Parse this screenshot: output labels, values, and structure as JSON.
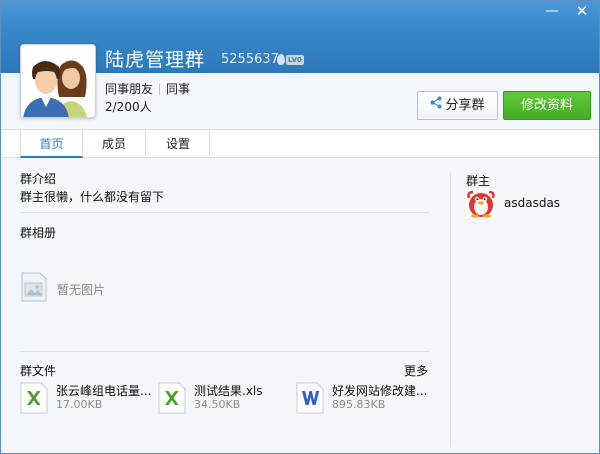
{
  "window": {
    "minimize_glyph": "—",
    "close_glyph": "✕"
  },
  "profile": {
    "name": "陆虎管理群",
    "group_id": "5255637",
    "level_badge": "LV0",
    "tags": [
      "同事朋友",
      "同事"
    ],
    "members": "2/200人",
    "avatar_icon": "group-avatar-icon"
  },
  "actions": {
    "share_label": "分享群",
    "edit_label": "修改资料"
  },
  "tabs": [
    {
      "label": "首页",
      "active": true
    },
    {
      "label": "成员",
      "active": false
    },
    {
      "label": "设置",
      "active": false
    }
  ],
  "intro": {
    "title": "群介绍",
    "text": "群主很懒，什么都没有留下"
  },
  "album": {
    "title": "群相册",
    "empty_text": "暂无图片"
  },
  "files": {
    "title": "群文件",
    "more_label": "更多",
    "items": [
      {
        "name": "张云峰组电话量...",
        "size": "17.00KB",
        "icon": "excel-icon"
      },
      {
        "name": "测试结果.xls",
        "size": "34.50KB",
        "icon": "excel-icon"
      },
      {
        "name": "好发网站修改建...",
        "size": "895.83KB",
        "icon": "word-icon"
      }
    ]
  },
  "owner": {
    "title": "群主",
    "name": "asdasdas",
    "avatar_icon": "penguin-avatar-icon"
  },
  "colors": {
    "header_blue": "#3887c9",
    "accent_blue": "#2b7bd1",
    "green_button": "#45ad22"
  }
}
